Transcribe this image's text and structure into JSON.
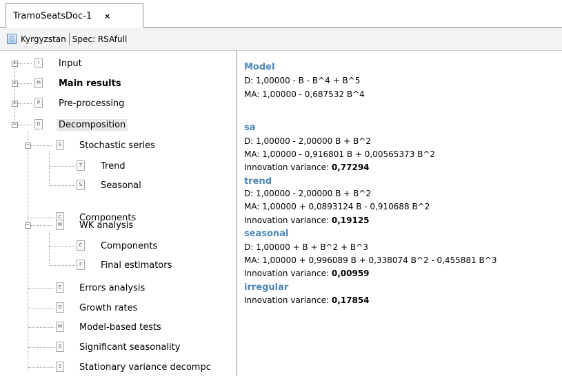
{
  "tab": {
    "title": "TramoSeatsDoc-1",
    "close": "×"
  },
  "subbar": {
    "country": "Kyrgyzstan",
    "spec": "Spec: RSAfull"
  },
  "tree": [
    {
      "label": "Input",
      "icon": "I",
      "exp": "+"
    },
    {
      "label": "Main results",
      "icon": "M",
      "exp": "+"
    },
    {
      "label": "Pre-processing",
      "icon": "P",
      "exp": "+"
    },
    {
      "label": "Decomposition",
      "icon": "D",
      "exp": "−"
    },
    {
      "label": "Stochastic series",
      "icon": "S",
      "exp": "−"
    },
    {
      "label": "Trend",
      "icon": "T",
      "exp": ""
    },
    {
      "label": "Seasonal",
      "icon": "S",
      "exp": ""
    },
    {
      "label": "Components",
      "icon": "C",
      "exp": ""
    },
    {
      "label": "WK analysis",
      "icon": "W",
      "exp": "−"
    },
    {
      "label": "Components",
      "icon": "C",
      "exp": ""
    },
    {
      "label": "Final estimators",
      "icon": "F",
      "exp": ""
    },
    {
      "label": "Errors analysis",
      "icon": "E",
      "exp": ""
    },
    {
      "label": "Growth rates",
      "icon": "G",
      "exp": ""
    },
    {
      "label": "Model-based tests",
      "icon": "M",
      "exp": ""
    },
    {
      "label": "Significant seasonality",
      "icon": "S",
      "exp": ""
    },
    {
      "label": "Stationary variance decompc",
      "icon": "S",
      "exp": ""
    }
  ],
  "content": {
    "model_h": "Model",
    "model_d": "D: 1,00000 - B - B^4 + B^5",
    "model_ma": "MA: 1,00000 - 0,687532 B^4",
    "sa_h": "sa",
    "sa_d": "D: 1,00000 - 2,00000 B + B^2",
    "sa_ma": "MA: 1,00000 - 0,916801 B + 0,00565373 B^2",
    "iv_label": "Innovation variance: ",
    "sa_iv": "0,77294",
    "trend_h": "trend",
    "trend_d": "D: 1,00000 - 2,00000 B + B^2",
    "trend_ma": "MA: 1,00000 + 0,0893124 B - 0,910688 B^2",
    "trend_iv": "0,19125",
    "seasonal_h": "seasonal",
    "seasonal_d": "D: 1,00000 + B + B^2 + B^3",
    "seasonal_ma": "MA: 1,00000 + 0,996089 B + 0,338074 B^2 - 0,455881 B^3",
    "seasonal_iv": "0,00959",
    "irregular_h": "irregular",
    "irregular_iv": "0,17854"
  }
}
